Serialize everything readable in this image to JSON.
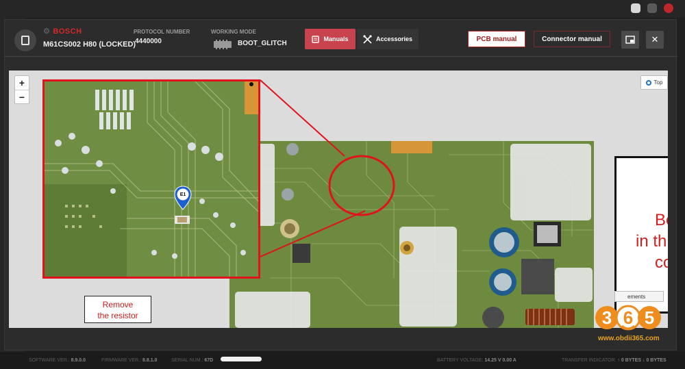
{
  "header": {
    "brand": "BOSCH",
    "model": "M61CS002 H80 (LOCKED)",
    "protocol_label": "PROTOCOL NUMBER",
    "protocol_value": "4440000",
    "mode_label": "WORKING MODE",
    "mode_value": "BOOT_GLITCH",
    "tabs": [
      {
        "label": "Manuals",
        "icon": "book-icon",
        "active": true
      },
      {
        "label": "Accessories",
        "icon": "tools-icon",
        "active": false
      }
    ],
    "pcb_manual": "PCB manual",
    "connector_manual": "Connector manual",
    "accent_color": "#c8434d"
  },
  "viewer": {
    "zoom_in": "+",
    "zoom_out": "−",
    "side_toggle": "Top",
    "pin_label": "E1",
    "callout_line1": "Remove",
    "callout_line2": "the resistor",
    "panel_line1": "Be",
    "panel_line2": "in th",
    "panel_line3": "co",
    "elements_tag": "ements"
  },
  "statusbar": {
    "software_label": "SOFTWARE VER.:",
    "software_value": "8.9.0.0",
    "firmware_label": "FIRMWARE VER.:",
    "firmware_value": "8.8.1.0",
    "serial_label": "SERIAL NUM.:",
    "serial_value": "67D",
    "battery_label": "BATTERY VOLTAGE:",
    "battery_v": "14.25 V",
    "battery_a": "0.00 A",
    "transfer_label": "TRANSFER INDICATOR:",
    "transfer_up": "0 BYTES",
    "transfer_down": "0 BYTES"
  },
  "watermark": {
    "digits": "365",
    "url": "www.obdii365.com"
  }
}
